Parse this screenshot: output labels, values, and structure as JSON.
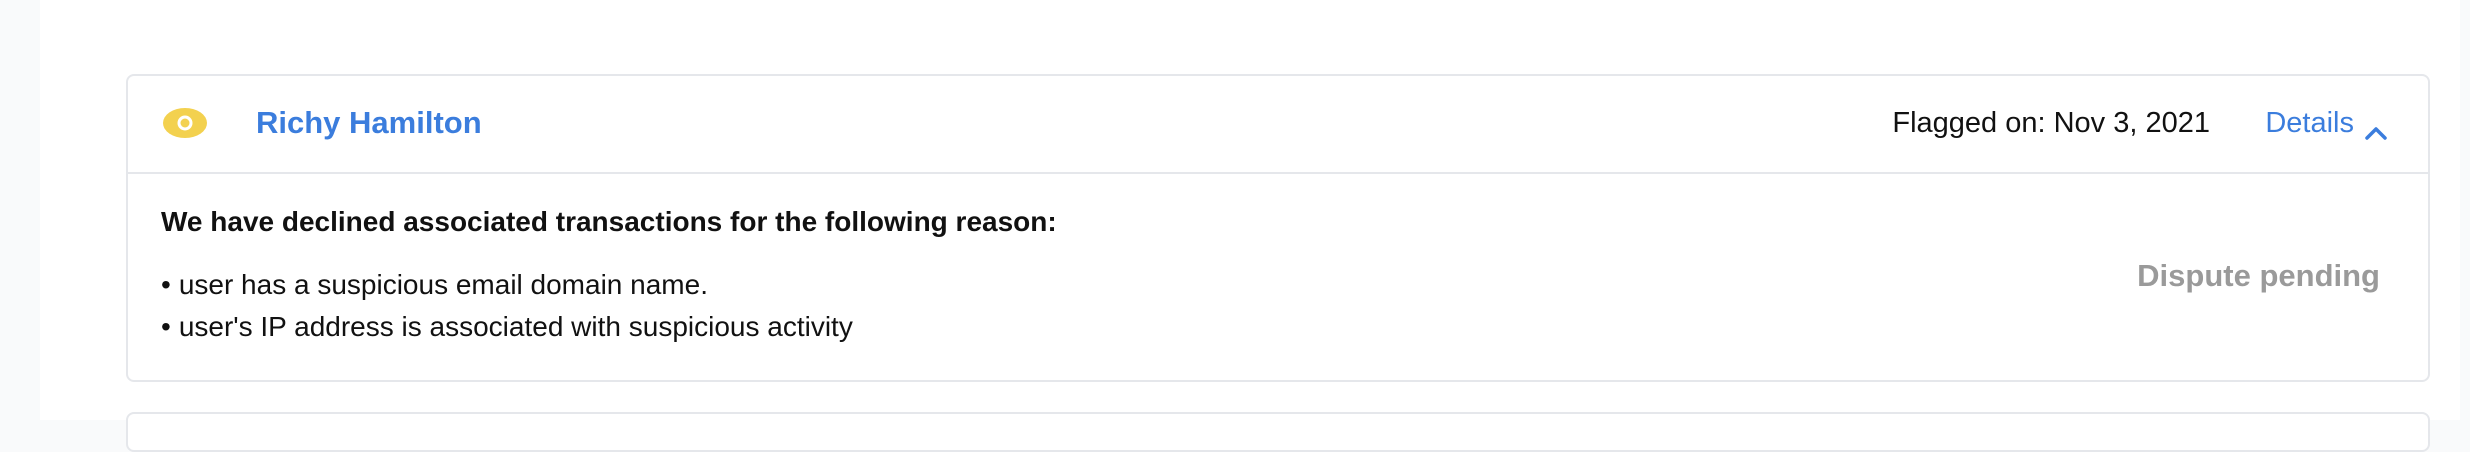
{
  "flag_card": {
    "user_name": "Richy Hamilton",
    "flagged_on": "Flagged on: Nov 3, 2021",
    "details_label": "Details",
    "icon": "eye-icon",
    "body": {
      "heading": "We have declined associated transactions for the following reason:",
      "reasons": [
        "user has a suspicious email domain name.",
        "user's IP address is associated with suspicious activity"
      ],
      "bullet": "•",
      "status": "Dispute pending"
    }
  },
  "colors": {
    "link": "#3b7ddd",
    "eye_icon": "#f3d14f",
    "status_muted": "#9a9a9a",
    "border": "#e5e7eb"
  }
}
